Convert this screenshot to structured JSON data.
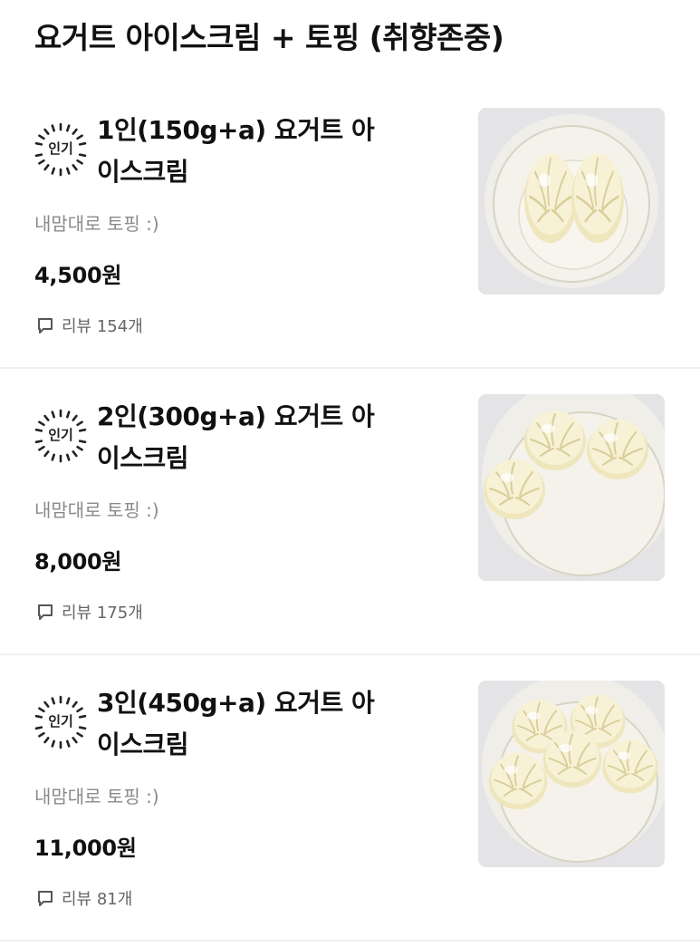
{
  "section": {
    "title": "요거트 아이스크림 + 토핑 (취향존중)"
  },
  "items": [
    {
      "badge": "인기",
      "name": "1인(150g+a) 요거트 아이스크림",
      "description": "내맘대로 토핑 :)",
      "price": "4,500원",
      "reviews": "리뷰 154개",
      "image_icon": "yogurt-cup-2-swirls"
    },
    {
      "badge": "인기",
      "name": "2인(300g+a) 요거트 아이스크림",
      "description": "내맘대로 토핑 :)",
      "price": "8,000원",
      "reviews": "리뷰 175개",
      "image_icon": "yogurt-cup-3-swirls"
    },
    {
      "badge": "인기",
      "name": "3인(450g+a) 요거트 아이스크림",
      "description": "내맘대로 토핑 :)",
      "price": "11,000원",
      "reviews": "리뷰 81개",
      "image_icon": "yogurt-cup-5-swirls"
    }
  ],
  "colors": {
    "text": "#111111",
    "muted": "#8a8a8a",
    "divider": "#f1f1f1",
    "cream": "#f6f0d6"
  }
}
